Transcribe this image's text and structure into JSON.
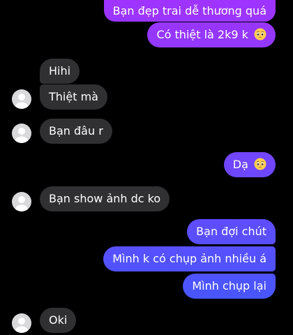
{
  "conversation": {
    "messages": [
      {
        "side": "out",
        "text": "Bạn đẹp trai dễ thương quá",
        "emoji": ""
      },
      {
        "side": "out",
        "text": "Có thiệt là 2k9 k",
        "emoji": "pleading-face"
      },
      {
        "side": "in",
        "text": "Hihi",
        "emoji": ""
      },
      {
        "side": "in",
        "text": "Thiệt mà",
        "emoji": ""
      },
      {
        "side": "in",
        "text": "Bạn đâu r",
        "emoji": ""
      },
      {
        "side": "out",
        "text": "Dạ",
        "emoji": "pleading-face"
      },
      {
        "side": "in",
        "text": "Bạn show ảnh dc ko",
        "emoji": ""
      },
      {
        "side": "out",
        "text": "Bạn đợi chút",
        "emoji": ""
      },
      {
        "side": "out",
        "text": "Mình k có chụp ảnh nhiều á",
        "emoji": ""
      },
      {
        "side": "out",
        "text": "Mình chụp lại",
        "emoji": ""
      },
      {
        "side": "in",
        "text": "Oki",
        "emoji": ""
      }
    ]
  },
  "colors": {
    "background": "#000000",
    "incoming_bubble": "#303033",
    "outgoing_gradient_top": "#a033ff",
    "outgoing_gradient_bottom": "#3d5afe",
    "avatar": "#d9d9dc"
  },
  "icons": {
    "avatar": "default-avatar-icon",
    "emoji": "pleading-face-emoji-icon"
  }
}
